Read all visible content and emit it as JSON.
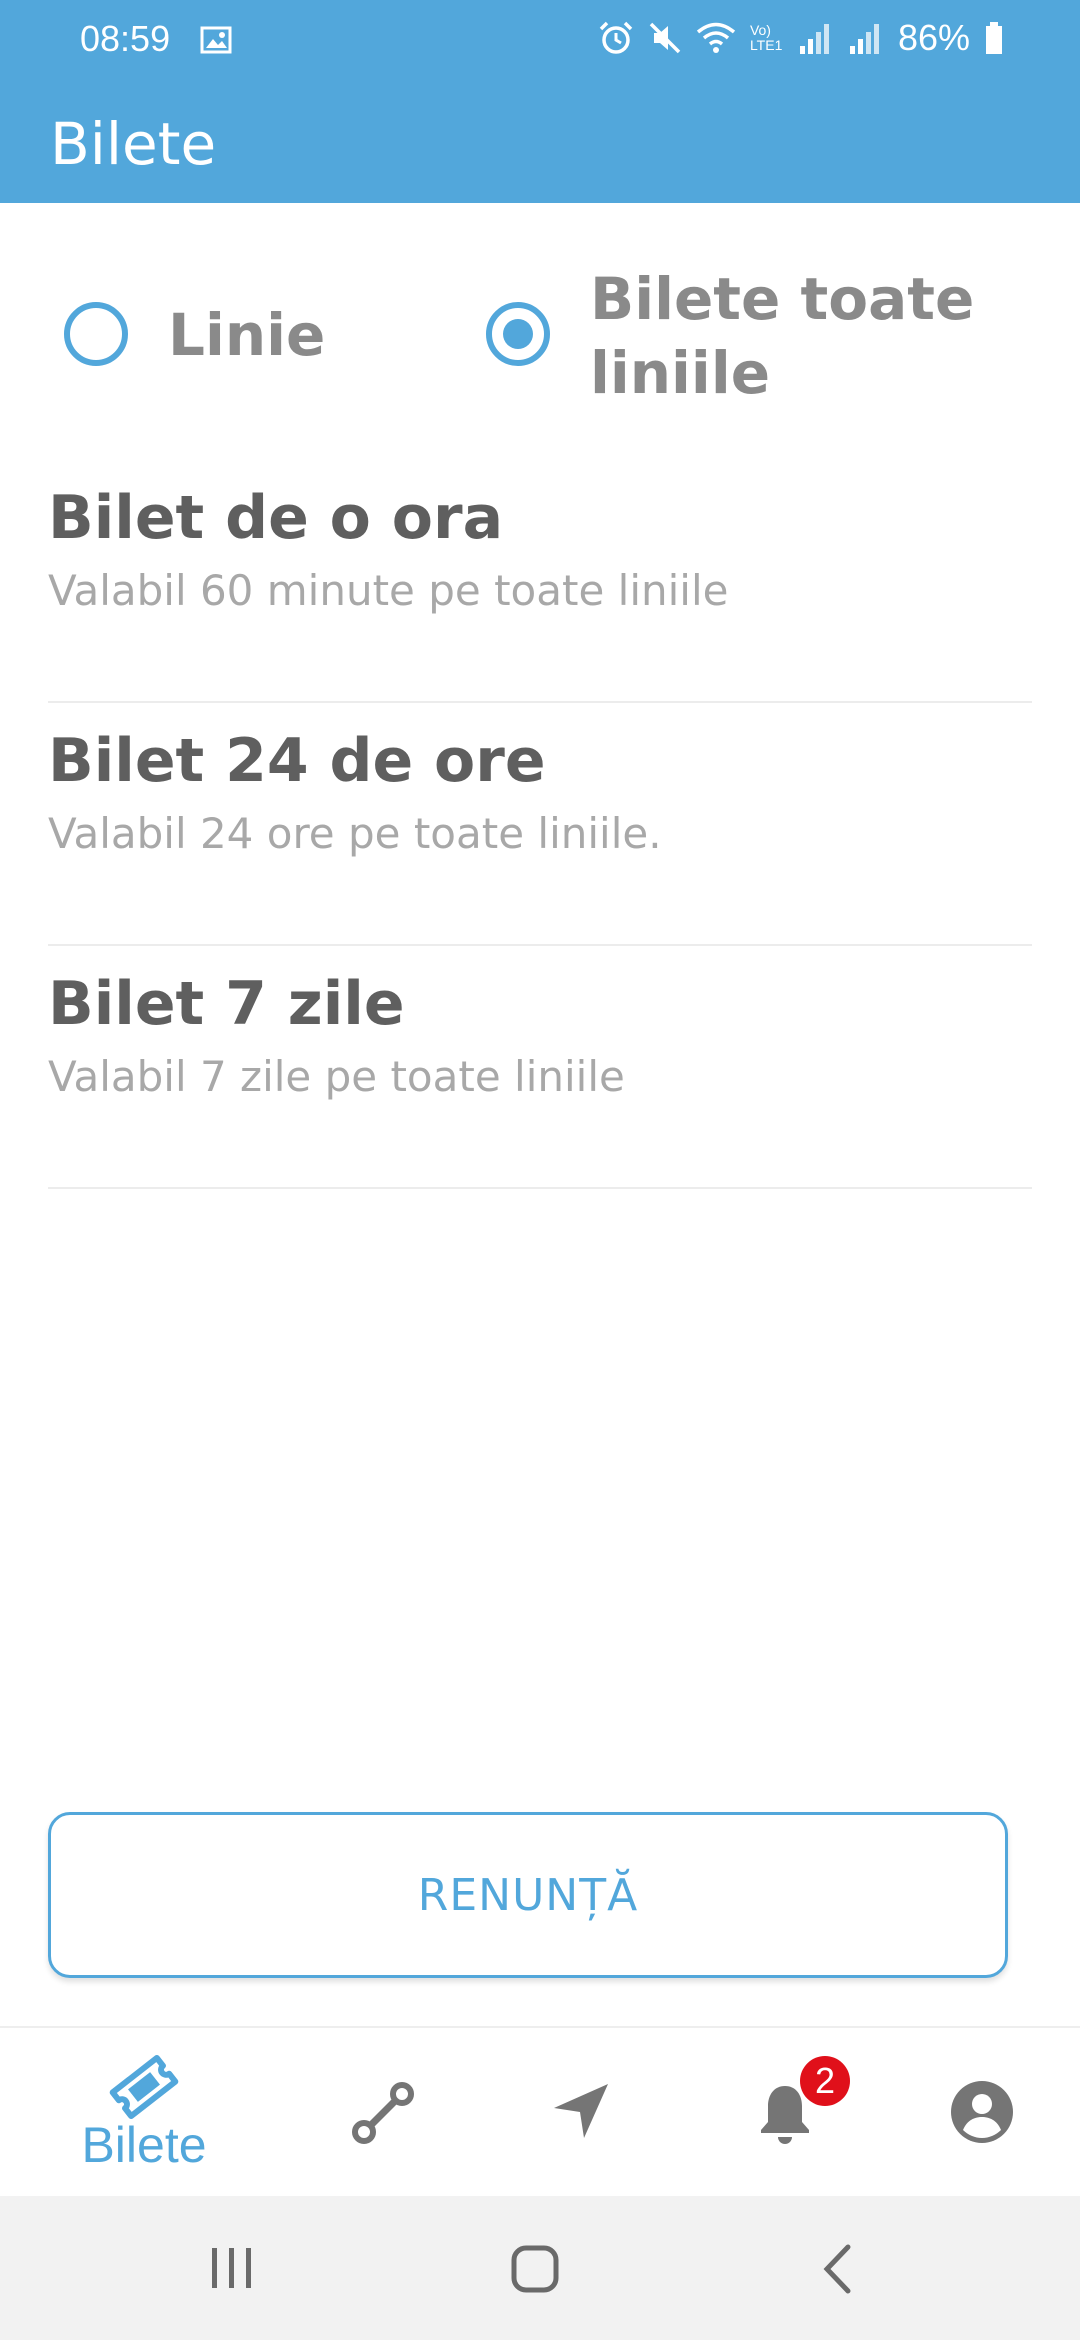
{
  "status_bar": {
    "time": "08:59",
    "battery": "86%",
    "network_label": "Vo) LTE1"
  },
  "app_bar": {
    "title": "Bilete"
  },
  "ticket_filter": {
    "options": [
      {
        "label": "Linie",
        "checked": false
      },
      {
        "label": "Bilete toate liniile",
        "checked": true
      }
    ]
  },
  "tickets": [
    {
      "title": "Bilet de o ora",
      "description": "Valabil 60 minute pe toate liniile"
    },
    {
      "title": "Bilet 24 de ore",
      "description": "Valabil 24 ore pe toate liniile."
    },
    {
      "title": "Bilet 7 zile",
      "description": "Valabil 7 zile pe toate liniile"
    }
  ],
  "cancel_button": {
    "label": "RENUNȚĂ"
  },
  "bottom_nav": {
    "items": [
      {
        "id": "tickets",
        "label": "Bilete",
        "icon": "ticket-icon",
        "active": true
      },
      {
        "id": "routes",
        "icon": "route-icon"
      },
      {
        "id": "navigate",
        "icon": "navigation-arrow-icon"
      },
      {
        "id": "notifications",
        "icon": "bell-icon",
        "badge": "2"
      },
      {
        "id": "profile",
        "icon": "account-circle-icon"
      }
    ]
  },
  "colors": {
    "primary": "#52a7db",
    "title_text": "#5f5f5f",
    "secondary_text": "#a8a8a8",
    "icon_gray": "#757575",
    "badge_red": "#e0101a"
  }
}
